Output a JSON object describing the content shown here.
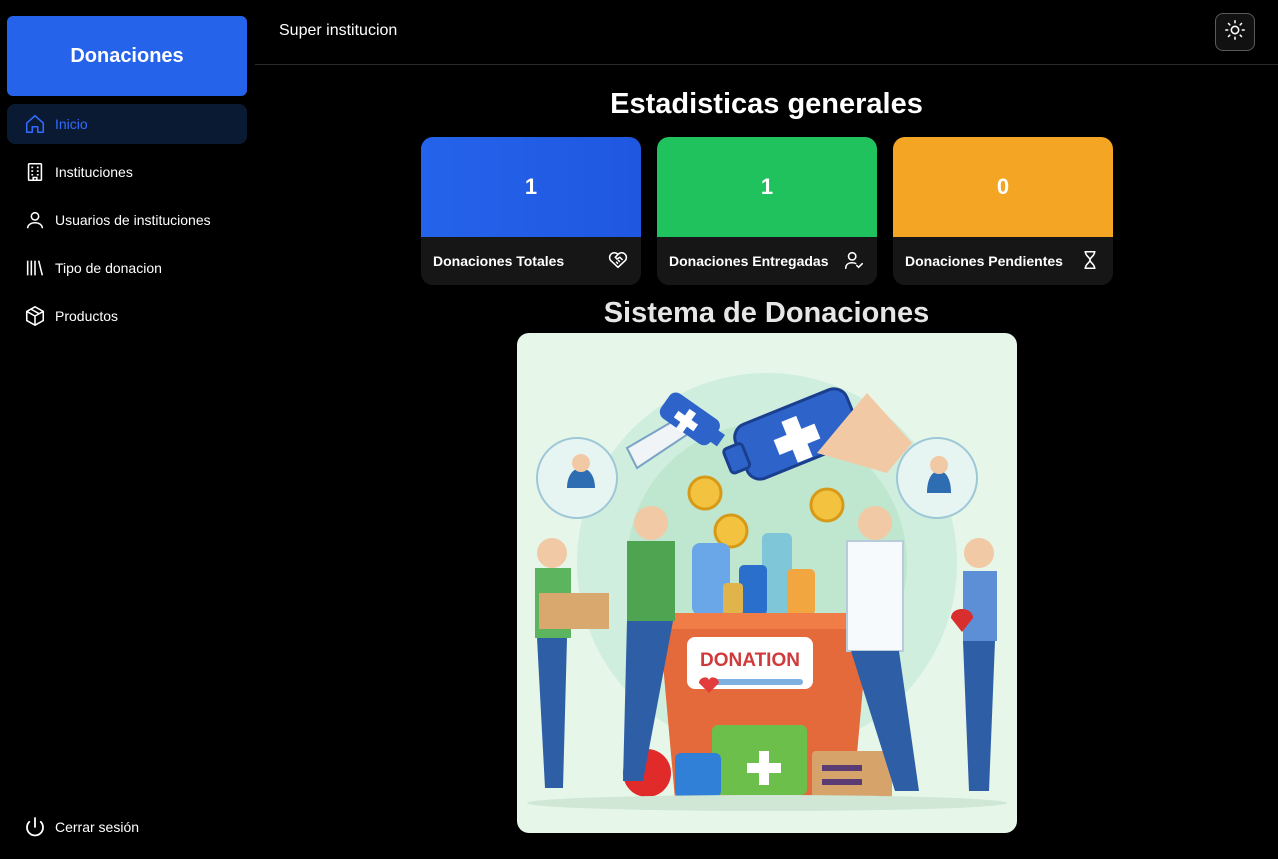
{
  "brand": {
    "title": "Donaciones",
    "color": "#2563eb"
  },
  "sidebar": {
    "items": [
      {
        "label": "Inicio",
        "icon": "home-icon",
        "active": true
      },
      {
        "label": "Instituciones",
        "icon": "building-icon"
      },
      {
        "label": "Usuarios de instituciones",
        "icon": "user-icon"
      },
      {
        "label": "Tipo de donacion",
        "icon": "library-icon"
      },
      {
        "label": "Productos",
        "icon": "box-icon"
      }
    ],
    "logout_label": "Cerrar sesión"
  },
  "header": {
    "org_name": "Super institucion",
    "theme_icon": "sun-icon"
  },
  "main": {
    "stats_title": "Estadisticas generales",
    "cards": [
      {
        "value": "1",
        "label": "Donaciones Totales",
        "icon": "heart-handshake-icon",
        "color": "#2563eb"
      },
      {
        "value": "1",
        "label": "Donaciones Entregadas",
        "icon": "user-check-icon",
        "color": "#1fc25c"
      },
      {
        "value": "0",
        "label": "Donaciones Pendientes",
        "icon": "hourglass-icon",
        "color": "#f5a524"
      }
    ],
    "system_title": "Sistema de Donaciones",
    "hero": {
      "banner_text": "DONATION"
    }
  }
}
